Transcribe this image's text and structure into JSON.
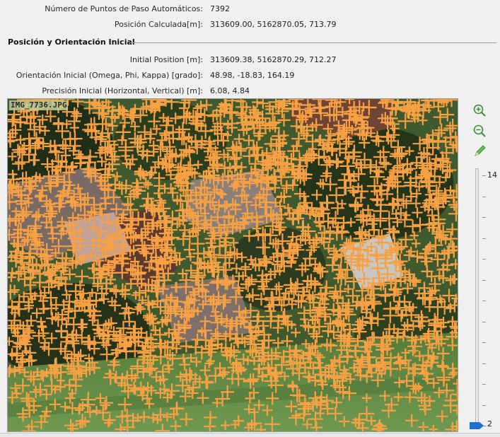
{
  "summary": {
    "auto_tie_points": {
      "label": "Número de Puntos de Paso Automáticos:",
      "value": "7392"
    },
    "computed_position": {
      "label": "Posición Calculada[m]:",
      "value": "313609.00, 5162870.05, 713.79"
    }
  },
  "initial": {
    "title": "Posición y Orientación Inicial",
    "position": {
      "label": "Initial Position [m]:",
      "value": "313609.38, 5162870.29, 712.27"
    },
    "orientation": {
      "label": "Orientación Inicial (Omega, Phi, Kappa) [grado]:",
      "value": "48.98, -18.83, 164.19"
    },
    "accuracy": {
      "label": "Precisión Inicial (Horizontal, Vertical) [m]:",
      "value": "6.08, 4.84"
    }
  },
  "image": {
    "filename": "IMG_7736.JPG",
    "marker_color": "#f7a044",
    "marker_count": 7392
  },
  "toolbar": {
    "zoom_in_icon": "zoom-in-icon",
    "zoom_out_icon": "zoom-out-icon",
    "edit_icon": "pencil-icon"
  },
  "zoom": {
    "max_label": "14",
    "min_label": "2",
    "level": 2,
    "accent": "#1e6fd0"
  }
}
